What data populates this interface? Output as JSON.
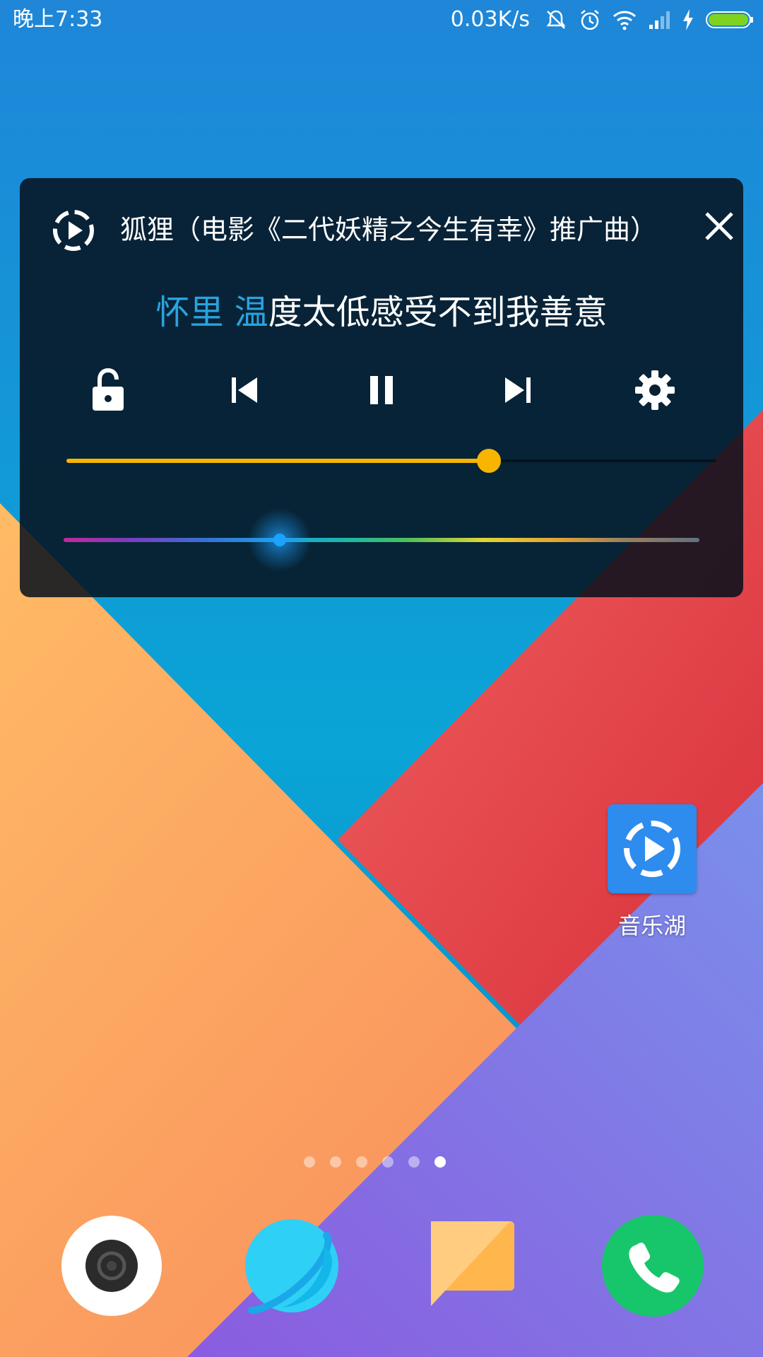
{
  "status_bar": {
    "time": "晚上7:33",
    "network_speed": "0.03K/s",
    "icons": [
      "mute-icon",
      "alarm-icon",
      "wifi-icon",
      "signal-icon",
      "charging-icon",
      "battery-icon"
    ],
    "battery_color": "#7ed321"
  },
  "music_widget": {
    "song_title": "狐狸（电影《二代妖精之今生有幸》推广曲）",
    "lyric_sung": "怀里 温",
    "lyric_unsung": "度太低感受不到我善意",
    "lyric_highlight_color": "#29a3e0",
    "controls": [
      "lock-icon",
      "previous-icon",
      "pause-icon",
      "next-icon",
      "settings-icon"
    ],
    "progress_fraction": 0.65,
    "progress_color": "#f7b500",
    "lyric_color_position_fraction": 0.34,
    "lyric_color_thumb": "#1ba3ff"
  },
  "home_screen": {
    "app_icon_label": "音乐湖",
    "page_count": 6,
    "active_page": 6,
    "dock": [
      "camera-icon",
      "browser-icon",
      "messages-icon",
      "phone-icon"
    ]
  }
}
